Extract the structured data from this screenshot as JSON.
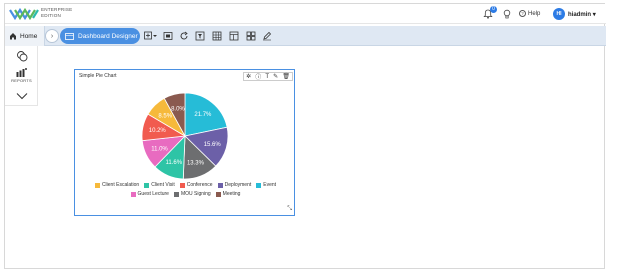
{
  "brand": {
    "line1": "ENTERPRISE",
    "line2": "EDITION",
    "colors": {
      "blue": "#4a90e2",
      "green": "#5cb85c",
      "teal": "#2bbbad"
    }
  },
  "header": {
    "notification_count": "0",
    "help_label": "Help",
    "avatar_initials": "HI",
    "username": "hiadmin"
  },
  "breadcrumb": {
    "home_label": "Home",
    "designer_label": "Dashboard Designer"
  },
  "left_panel": {
    "reports_label": "REPORTS"
  },
  "widget": {
    "title": "Simple Pie Chart"
  },
  "chart_data": {
    "type": "pie",
    "title": "Simple Pie Chart",
    "slices": [
      {
        "name": "Event",
        "value": 21.7,
        "label": "21.7%",
        "color": "#26bcd7"
      },
      {
        "name": "Deployment",
        "value": 15.6,
        "label": "15.6%",
        "color": "#6c60a8"
      },
      {
        "name": "MOU Signing",
        "value": 13.3,
        "label": "13.3%",
        "color": "#6d6e70"
      },
      {
        "name": "Client Visit",
        "value": 11.6,
        "label": "11.6%",
        "color": "#2ec4a6"
      },
      {
        "name": "Guest Lecture",
        "value": 11.0,
        "label": "11.0%",
        "color": "#e86bc0"
      },
      {
        "name": "Conference",
        "value": 10.2,
        "label": "10.2%",
        "color": "#f15b4f"
      },
      {
        "name": "Client Escalation",
        "value": 8.5,
        "label": "8.5%",
        "color": "#f6b93b"
      },
      {
        "name": "Meeting",
        "value": 8.0,
        "label": "8.0%",
        "color": "#8a5a4f"
      }
    ],
    "legend_rows": [
      [
        "Client Escalation",
        "Client Visit",
        "Conference",
        "Deployment",
        "Event"
      ],
      [
        "Guest Lecture",
        "MOU Signing",
        "Meeting"
      ]
    ],
    "legend_position": "bottom"
  }
}
